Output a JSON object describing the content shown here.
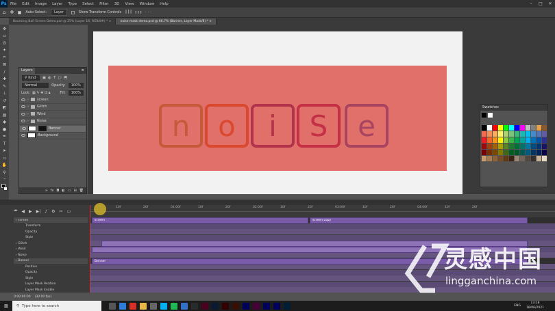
{
  "menu": {
    "items": [
      "File",
      "Edit",
      "Image",
      "Layer",
      "Type",
      "Select",
      "Filter",
      "3D",
      "View",
      "Window",
      "Help"
    ]
  },
  "options": {
    "auto_select_label": "Auto-Select:",
    "auto_select_value": "Layer",
    "show_transform_label": "Show Transform Controls"
  },
  "tabs": [
    {
      "label": "Bouncing Ball Screen Demo.psd @ 25% (Layer 16, RGB/8#) *"
    },
    {
      "label": "noise mask demo.psd @ 66.7% (Banner, Layer Mask/8) *"
    }
  ],
  "layers_panel": {
    "title": "Layers",
    "kind_value": "Kind",
    "blend_value": "Normal",
    "opacity_label": "Opacity:",
    "opacity_value": "100%",
    "lock_label": "Lock:",
    "fill_label": "Fill:",
    "fill_value": "100%",
    "layers": [
      {
        "name": "screen",
        "type": "group"
      },
      {
        "name": "Glitch",
        "type": "group"
      },
      {
        "name": "Wind",
        "type": "group"
      },
      {
        "name": "Noise",
        "type": "group"
      },
      {
        "name": "Banner",
        "type": "masked"
      },
      {
        "name": "Background",
        "type": "background"
      }
    ]
  },
  "canvas": {
    "letters": [
      "n",
      "o",
      "i",
      "S",
      "e"
    ],
    "letter_colors": [
      "#c55a3b",
      "#d9482f",
      "#b2334a",
      "#c43046",
      "#a8445f"
    ],
    "pink": "#e07069"
  },
  "swatches": {
    "title": "Swatches",
    "colors": [
      "#000000",
      "#ffffff",
      "#ff0000",
      "#ffff00",
      "#00ff00",
      "#00ffff",
      "#0000ff",
      "#ff00ff",
      "#c0c0c0",
      "#808080",
      "#e8a04a",
      "#8a5a2b",
      "#f26c4f",
      "#f68e55",
      "#fbaf5d",
      "#fff467",
      "#acd372",
      "#7cc576",
      "#3bb878",
      "#1abbb4",
      "#00bff3",
      "#438ccb",
      "#5574b9",
      "#605ca8",
      "#ed1c24",
      "#f26522",
      "#f7941d",
      "#fff200",
      "#8dc73f",
      "#39b54a",
      "#00a651",
      "#00a99d",
      "#00aeef",
      "#0072bc",
      "#0054a6",
      "#2e3192",
      "#9e0b0f",
      "#a0410d",
      "#a36209",
      "#aba000",
      "#598527",
      "#1a7b30",
      "#007236",
      "#00746b",
      "#0076a3",
      "#004b80",
      "#003471",
      "#1b1464",
      "#790000",
      "#7b2e00",
      "#7d4900",
      "#827b00",
      "#406618",
      "#005e20",
      "#005826",
      "#005952",
      "#005b7f",
      "#003663",
      "#002157",
      "#0d004c",
      "#c69c6d",
      "#a67c52",
      "#8c6239",
      "#754c24",
      "#603913",
      "#3c2415",
      "#998675",
      "#736357",
      "#534741",
      "#362f2d",
      "#c7b299",
      "#e6d8c3"
    ]
  },
  "timeline": {
    "ruler_labels": [
      "10f",
      "20f",
      "01:00f",
      "10f",
      "20f",
      "02:00f",
      "10f",
      "20f",
      "03:00f",
      "10f",
      "20f",
      "04:00f",
      "10f",
      "20f"
    ],
    "rows": [
      {
        "label": "screen",
        "indent": 0,
        "header": true
      },
      {
        "label": "Transform",
        "indent": 1
      },
      {
        "label": "Opacity",
        "indent": 1
      },
      {
        "label": "Style",
        "indent": 1
      },
      {
        "label": "Glitch",
        "indent": 0
      },
      {
        "label": "Wind",
        "indent": 0
      },
      {
        "label": "Noise",
        "indent": 0
      },
      {
        "label": "Banner",
        "indent": 0,
        "header": true
      },
      {
        "label": "Position",
        "indent": 1
      },
      {
        "label": "Opacity",
        "indent": 1
      },
      {
        "label": "Style",
        "indent": 1
      },
      {
        "label": "Layer Mask Position",
        "indent": 1
      },
      {
        "label": "Layer Mask Enable",
        "indent": 1
      }
    ],
    "clip_screen": "screen",
    "clip_screen_copy": "screen copy",
    "clip_banner": "Banner",
    "timecode": "0:00:00:00",
    "fps": "(30.00 fps)"
  },
  "taskbar": {
    "search_placeholder": "Type here to search",
    "lang": "ENG",
    "time": "13:18",
    "date": "18/06/2021"
  },
  "watermark": {
    "cn": "灵感中国",
    "url": "lingganchina.com"
  }
}
